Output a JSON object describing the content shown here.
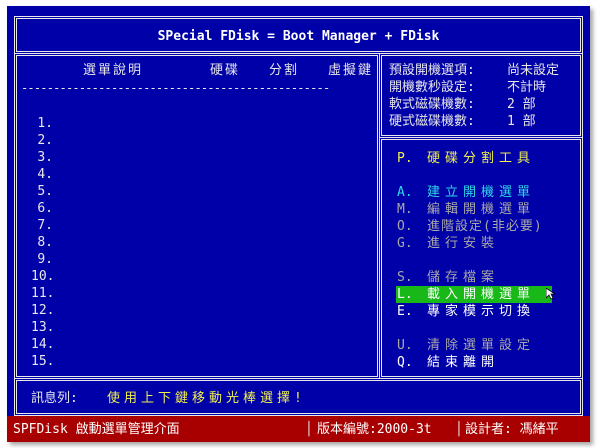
{
  "title": "SPecial FDisk = Boot Manager + FDisk",
  "left_panel": {
    "headers": [
      "選單說明",
      "硬碟",
      "分割",
      "虛擬鍵"
    ],
    "separator": "------------------------------------------------",
    "rows": [
      "1.",
      "2.",
      "3.",
      "4.",
      "5.",
      "6.",
      "7.",
      "8.",
      "9.",
      "10.",
      "11.",
      "12.",
      "13.",
      "14.",
      "15."
    ]
  },
  "settings": [
    {
      "label": "預設開機選項:",
      "value": "尚未設定"
    },
    {
      "label": "開機數秒設定:",
      "value": "不計時"
    },
    {
      "label": "軟式磁碟機數:",
      "value": "2 部"
    },
    {
      "label": "硬式磁碟機數:",
      "value": "1 部"
    }
  ],
  "menu": {
    "partition_tool": {
      "key": "P.",
      "label": "硬碟分割工具"
    },
    "items": [
      {
        "key": "A.",
        "label": "建立開機選單",
        "style": "cyan"
      },
      {
        "key": "M.",
        "label": "編輯開機選單",
        "style": "dim"
      },
      {
        "key": "O.",
        "label": "進階設定(非必要)",
        "style": "dim"
      },
      {
        "key": "G.",
        "label": "進行安裝",
        "style": "dim"
      },
      {
        "key": "S.",
        "label": "儲存檔案",
        "style": "dim"
      },
      {
        "key": "L.",
        "label": "載入開機選單",
        "style": "highlight"
      },
      {
        "key": "E.",
        "label": "專家模示切換",
        "style": "bright"
      },
      {
        "key": "U.",
        "label": "清除選單設定",
        "style": "dim"
      },
      {
        "key": "Q.",
        "label": "結束離開",
        "style": "bright"
      }
    ]
  },
  "status": {
    "label": "訊息列:",
    "message": "使用上下鍵移動光棒選擇!"
  },
  "bottom_bar": {
    "app": "SPFDisk 啟動選單管理介面",
    "version": "版本編號:2000-3t",
    "author": "設計者: 馮緒平"
  }
}
